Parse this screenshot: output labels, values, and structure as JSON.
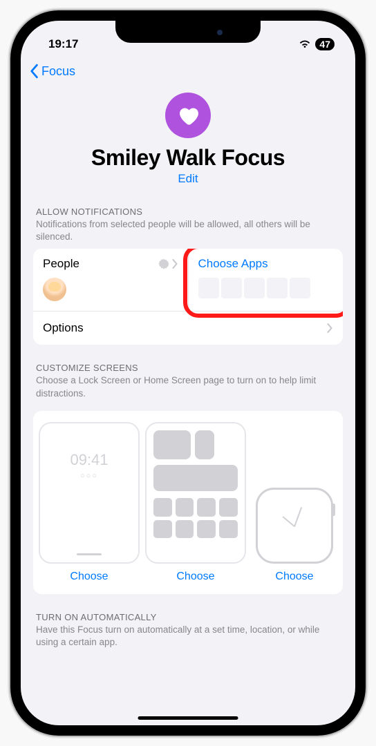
{
  "status": {
    "time": "19:17",
    "battery": "47"
  },
  "nav": {
    "back": "Focus"
  },
  "hero": {
    "title": "Smiley Walk Focus",
    "edit": "Edit"
  },
  "sections": {
    "allow_notifications": {
      "header": "ALLOW NOTIFICATIONS",
      "subtitle": "Notifications from selected people will be allowed, all others will be silenced.",
      "people_label": "People",
      "apps_label": "Choose Apps",
      "options_label": "Options"
    },
    "customize_screens": {
      "header": "CUSTOMIZE SCREENS",
      "subtitle": "Choose a Lock Screen or Home Screen page to turn on to help limit distractions.",
      "lock_time": "09:41",
      "choose": "Choose"
    },
    "auto": {
      "header": "TURN ON AUTOMATICALLY",
      "subtitle": "Have this Focus turn on automatically at a set time, location, or while using a certain app."
    }
  }
}
